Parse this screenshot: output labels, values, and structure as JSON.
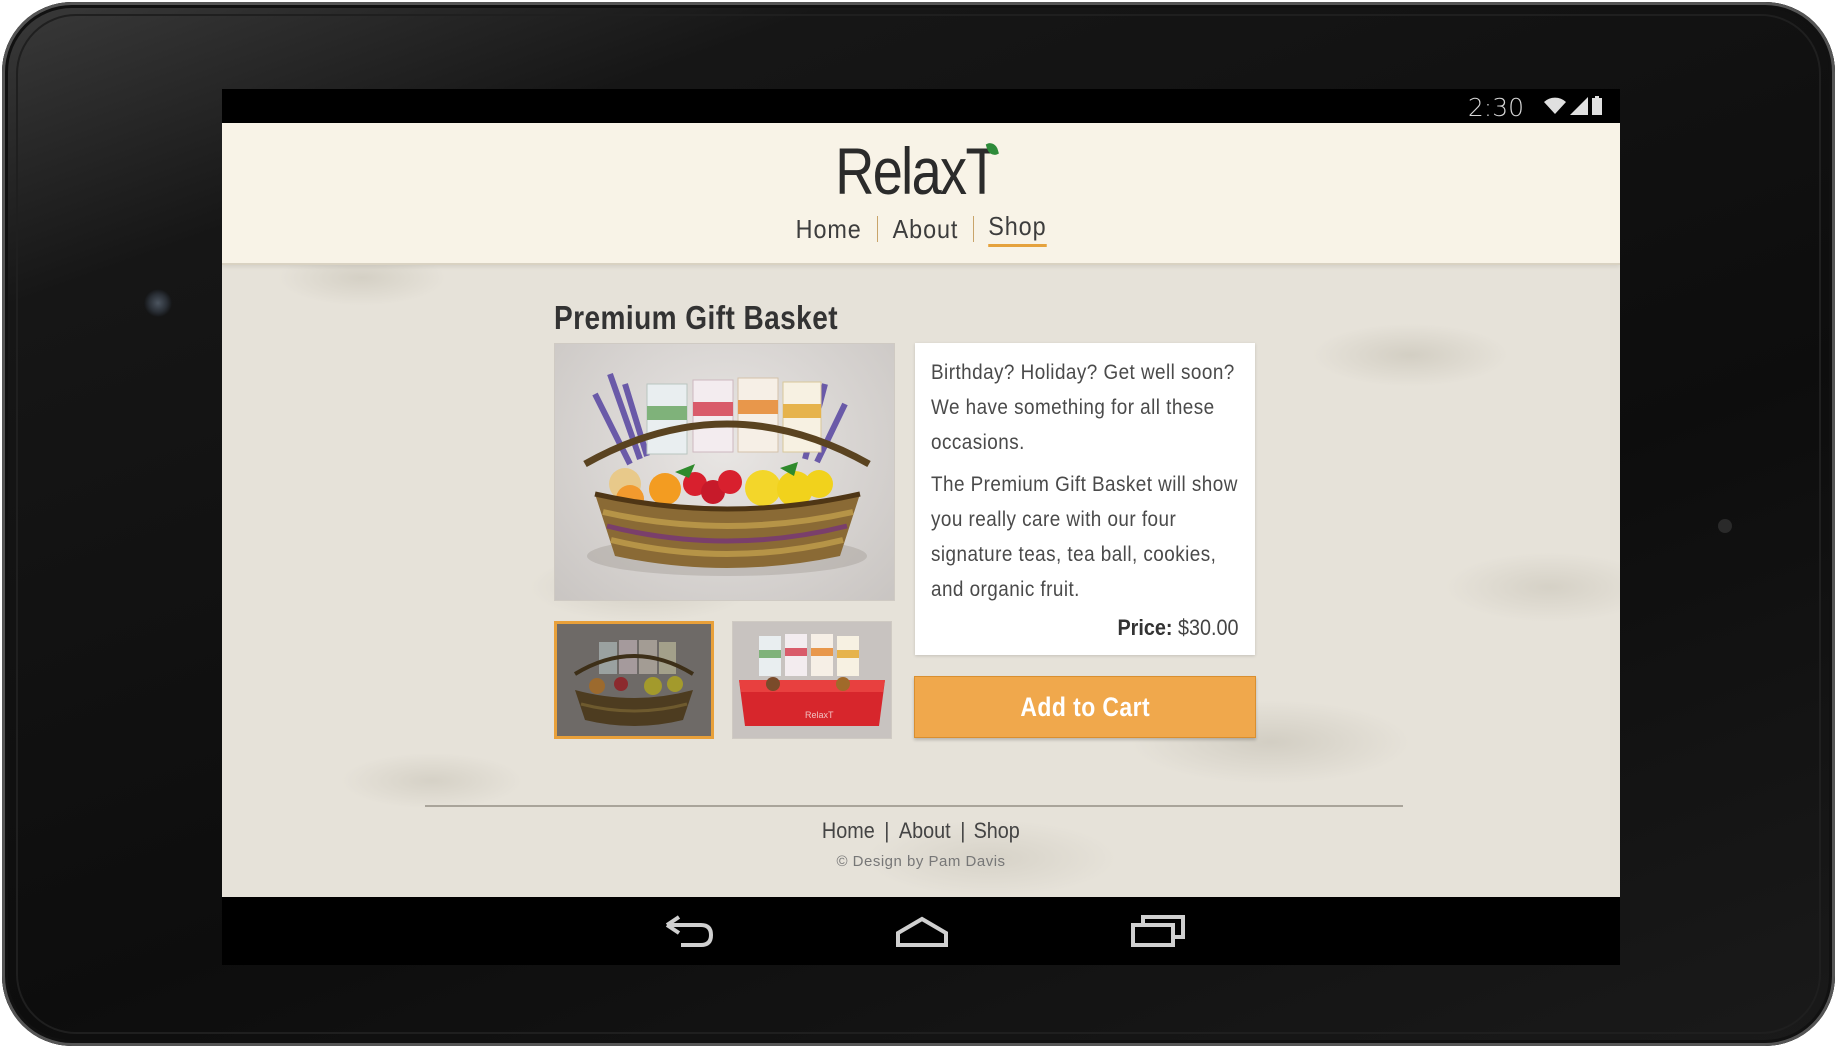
{
  "status_bar": {
    "time": "2:30",
    "icons": [
      "wifi-icon",
      "signal-icon",
      "battery-icon"
    ]
  },
  "site": {
    "logo": "RelaxT",
    "nav": [
      {
        "label": "Home",
        "active": false
      },
      {
        "label": "About",
        "active": false
      },
      {
        "label": "Shop",
        "active": true
      }
    ]
  },
  "product": {
    "title": "Premium Gift Basket",
    "description": [
      "Birthday? Holiday? Get well soon? We have something for all these occasions.",
      "The Premium Gift Basket will show you really care with our four signature teas, tea ball, cookies, and organic fruit."
    ],
    "price_label": "Price:",
    "price_value": "$30.00",
    "add_to_cart": "Add to Cart",
    "thumbnails": [
      {
        "name": "basket-wicker-thumbnail",
        "selected": true
      },
      {
        "name": "basket-red-box-thumbnail",
        "selected": false
      }
    ]
  },
  "footer": {
    "nav": [
      "Home",
      "About",
      "Shop"
    ],
    "separator": "|",
    "copyright": "© Design by Pam Davis"
  },
  "system_nav": {
    "buttons": [
      "back-icon",
      "home-icon",
      "recent-apps-icon"
    ]
  },
  "colors": {
    "accent": "#f0a84c",
    "header_bg": "#f8f3e7",
    "text": "#333333"
  }
}
